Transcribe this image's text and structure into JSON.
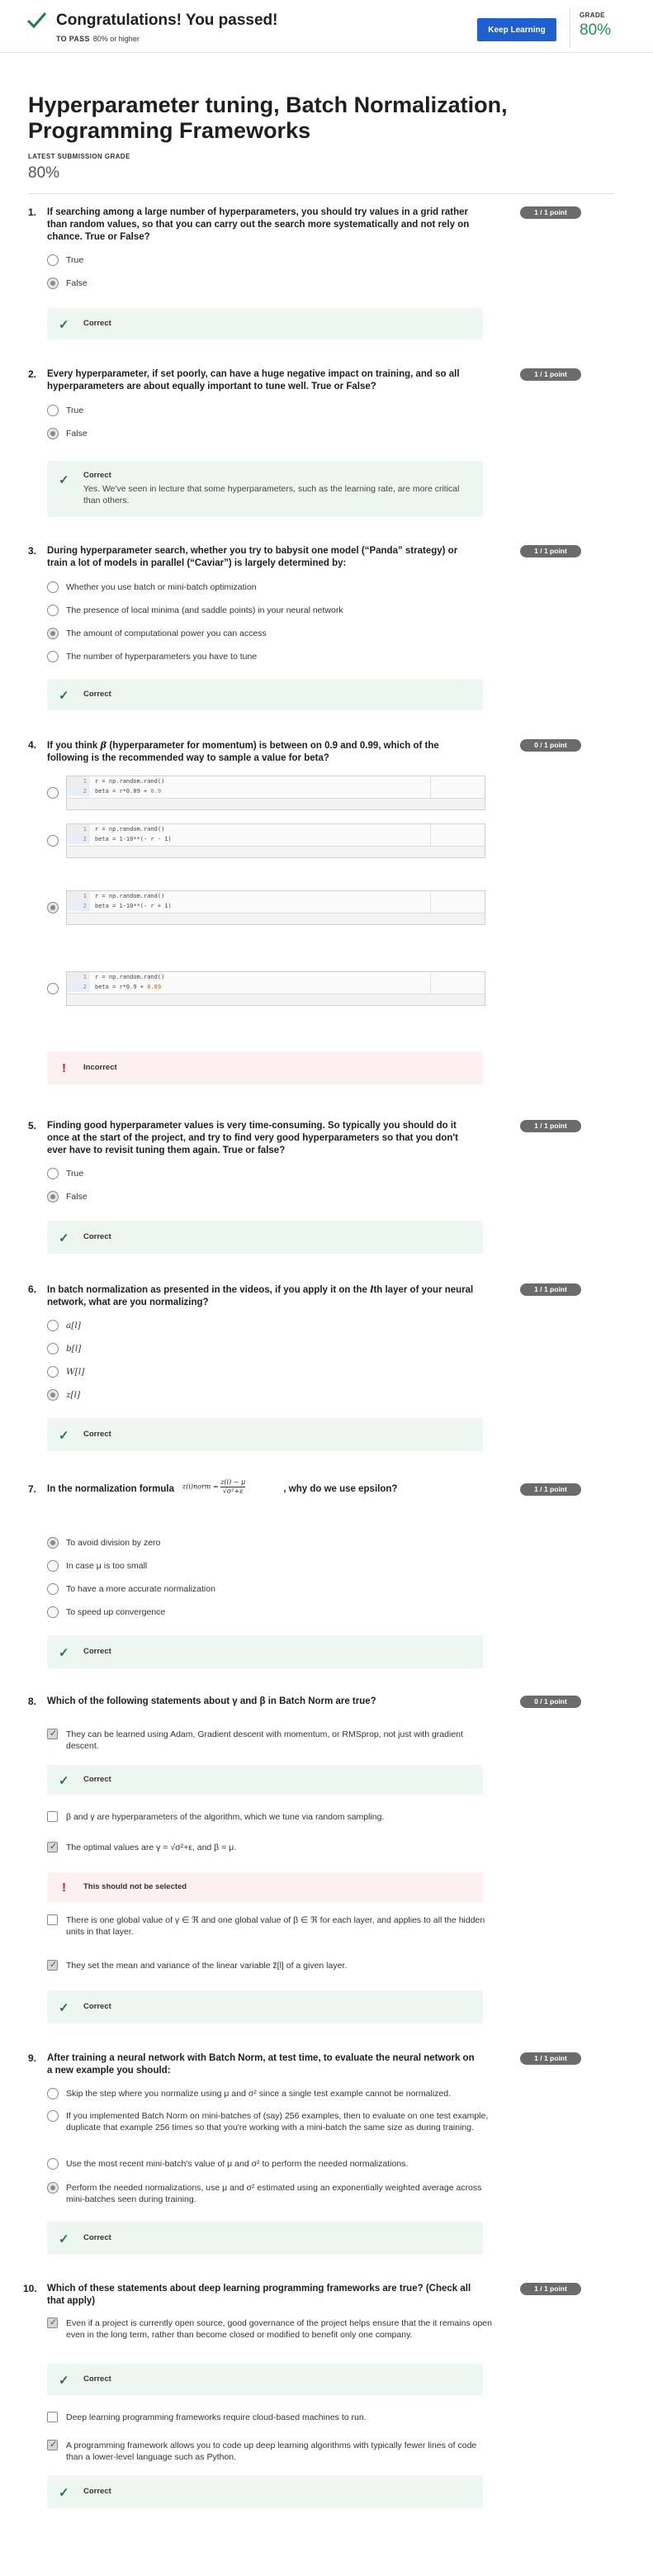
{
  "banner": {
    "title": "Congratulations! You passed!",
    "to_pass_label": "TO PASS",
    "to_pass_value": "80% or higher",
    "keep_button": "Keep Learning",
    "grade_label": "GRADE",
    "grade_value": "80%"
  },
  "quiz_title": "Hyperparameter tuning, Batch Normalization, Programming Frameworks",
  "latest_label": "LATEST SUBMISSION GRADE",
  "latest_value": "80%",
  "colors": {
    "correct": "#1f7a4d",
    "incorrect": "#c0232a",
    "primary_button": "#1f5fce",
    "grade": "#2a8a5a"
  },
  "q1": {
    "num": "1.",
    "points": "1 / 1 point",
    "text": "If searching among a large number of hyperparameters, you should try values in a grid rather than random values, so that you can carry out the search more systematically and not rely on chance. True or False?",
    "options": [
      "True",
      "False"
    ],
    "feedback": "Correct"
  },
  "q2": {
    "num": "2.",
    "points": "1 / 1 point",
    "text": "Every hyperparameter, if set poorly, can have a huge negative impact on training, and so all hyperparameters are about equally important to tune well. True or False?",
    "options": [
      "True",
      "False"
    ],
    "feedback": "Correct",
    "explanation": "Yes. We've seen in lecture that some hyperparameters, such as the learning rate, are more critical than others."
  },
  "q3": {
    "num": "3.",
    "points": "1 / 1 point",
    "text": "During hyperparameter search, whether you try to babysit one model (“Panda” strategy) or train a lot of models in parallel (“Caviar”) is largely determined by:",
    "options": [
      "Whether you use batch or mini-batch optimization",
      "The presence of local minima (and saddle points) in your neural network",
      "The amount of computational power you can access",
      "The number of hyperparameters you have to tune"
    ],
    "feedback": "Correct"
  },
  "q4": {
    "num": "4.",
    "points": "0 / 1 point",
    "text_a": "If you think ",
    "beta": "β",
    "text_b": " (hyperparameter for momentum) is between on 0.9 and 0.99, which of the following is the recommended way to sample a value for beta?",
    "code": [
      {
        "l1": "r = np.random.rand()",
        "l2a": "beta = r*0.09 + ",
        "l2b": "0.9"
      },
      {
        "l1": "r = np.random.rand()",
        "l2a": "beta = 1-10**(- r - 1)",
        "l2b": ""
      },
      {
        "l1": "r = np.random.rand()",
        "l2a": "beta = 1-10**(- r + 1)",
        "l2b": ""
      },
      {
        "l1": "r = np.random.rand()",
        "l2a": "beta = r*0.9 + ",
        "l2b": "0.09"
      }
    ],
    "line_nums": [
      "1",
      "2"
    ],
    "feedback": "Incorrect"
  },
  "q5": {
    "num": "5.",
    "points": "1 / 1 point",
    "text": "Finding good hyperparameter values is very time-consuming. So typically you should do it once at the start of the project, and try to find very good hyperparameters so that you don't ever have to revisit tuning them again. True or false?",
    "options": [
      "True",
      "False"
    ],
    "feedback": "Correct"
  },
  "q6": {
    "num": "6.",
    "points": "1 / 1 point",
    "text_a": "In batch normalization as presented in the videos, if you apply it on the ",
    "l": "l",
    "text_b": "th layer of your neural network, what are you normalizing?",
    "options": [
      "a[l]",
      "b[l]",
      "W[l]",
      "z[l]"
    ],
    "feedback": "Correct"
  },
  "q7": {
    "num": "7.",
    "points": "1 / 1 point",
    "text_a": "In the normalization formula ",
    "formula_lhs": "z(i)norm =",
    "formula_num": "z(i) − μ",
    "formula_den": "√σ²+ε",
    "text_b": ", why do we use epsilon?",
    "options": [
      "To avoid division by zero",
      "In case μ is too small",
      "To have a more accurate normalization",
      "To speed up convergence"
    ],
    "feedback": "Correct"
  },
  "q8": {
    "num": "8.",
    "points": "0 / 1 point",
    "text": "Which of the following statements about γ and β in Batch Norm are true?",
    "options": [
      "They can be learned using Adam, Gradient descent with momentum, or RMSprop, not just with gradient descent.",
      "β and γ are hyperparameters of the algorithm, which we tune via random sampling.",
      "The optimal values are γ = √σ²+ε, and β = μ.",
      "There is one global value of γ ∈ ℜ and one global value of β ∈ ℜ for each layer, and applies to all the hidden units in that layer.",
      "They set the mean and variance of the linear variable z̃[l] of a given layer."
    ],
    "feedback_correct": "Correct",
    "feedback_wrong": "This should not be selected"
  },
  "q9": {
    "num": "9.",
    "points": "1 / 1 point",
    "text": "After training a neural network with Batch Norm, at test time, to evaluate the neural network on a new example you should:",
    "options": [
      "Skip the step where you normalize using μ and σ² since a single test example cannot be normalized.",
      "If you implemented Batch Norm on mini-batches of (say) 256 examples, then to evaluate on one test example, duplicate that example 256 times so that you're working with a mini-batch the same size as during training.",
      "Use the most recent mini-batch's value of μ and σ² to perform the needed normalizations.",
      "Perform the needed normalizations, use μ and σ² estimated using an exponentially weighted average across mini-batches seen during training."
    ],
    "feedback": "Correct"
  },
  "q10": {
    "num": "10.",
    "points": "1 / 1 point",
    "text": "Which of these statements about deep learning programming frameworks are true? (Check all that apply)",
    "options": [
      "Even if a project is currently open source, good governance of the project helps ensure that the it remains open even in the long term, rather than become closed or modified to benefit only one company.",
      "Deep learning programming frameworks require cloud-based machines to run.",
      "A programming framework allows you to code up deep learning algorithms with typically fewer lines of code than a lower-level language such as Python."
    ],
    "feedback": "Correct"
  }
}
